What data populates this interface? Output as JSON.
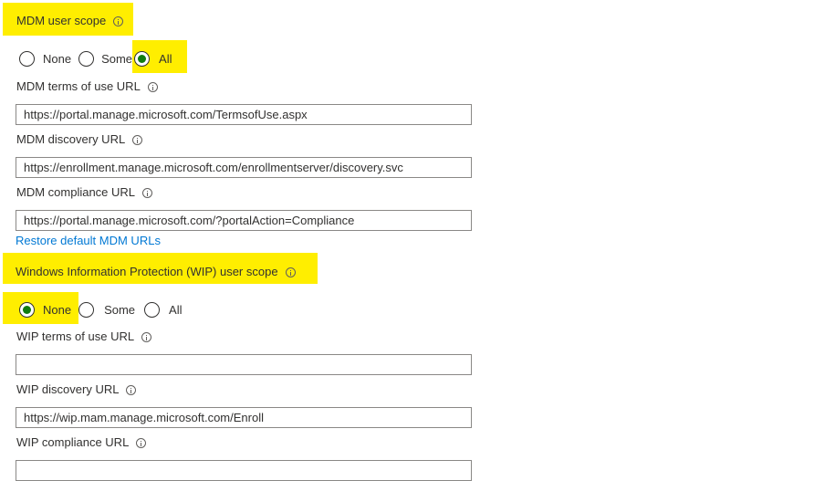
{
  "mdm": {
    "scope_label": "MDM user scope",
    "scope_options": [
      "None",
      "Some",
      "All"
    ],
    "scope_selected": "All",
    "terms_label": "MDM terms of use URL",
    "terms_value": "https://portal.manage.microsoft.com/TermsofUse.aspx",
    "discovery_label": "MDM discovery URL",
    "discovery_value": "https://enrollment.manage.microsoft.com/enrollmentserver/discovery.svc",
    "compliance_label": "MDM compliance URL",
    "compliance_value": "https://portal.manage.microsoft.com/?portalAction=Compliance",
    "restore_link": "Restore default MDM URLs"
  },
  "wip": {
    "scope_label": "Windows Information Protection (WIP) user scope",
    "scope_options": [
      "None",
      "Some",
      "All"
    ],
    "scope_selected": "None",
    "terms_label": "WIP terms of use URL",
    "terms_value": "",
    "discovery_label": "WIP discovery URL",
    "discovery_value": "https://wip.mam.manage.microsoft.com/Enroll",
    "compliance_label": "WIP compliance URL",
    "compliance_value": ""
  },
  "colors": {
    "highlight": "#ffee00",
    "accent": "#0078d4",
    "radio_checked": "#107c10"
  }
}
